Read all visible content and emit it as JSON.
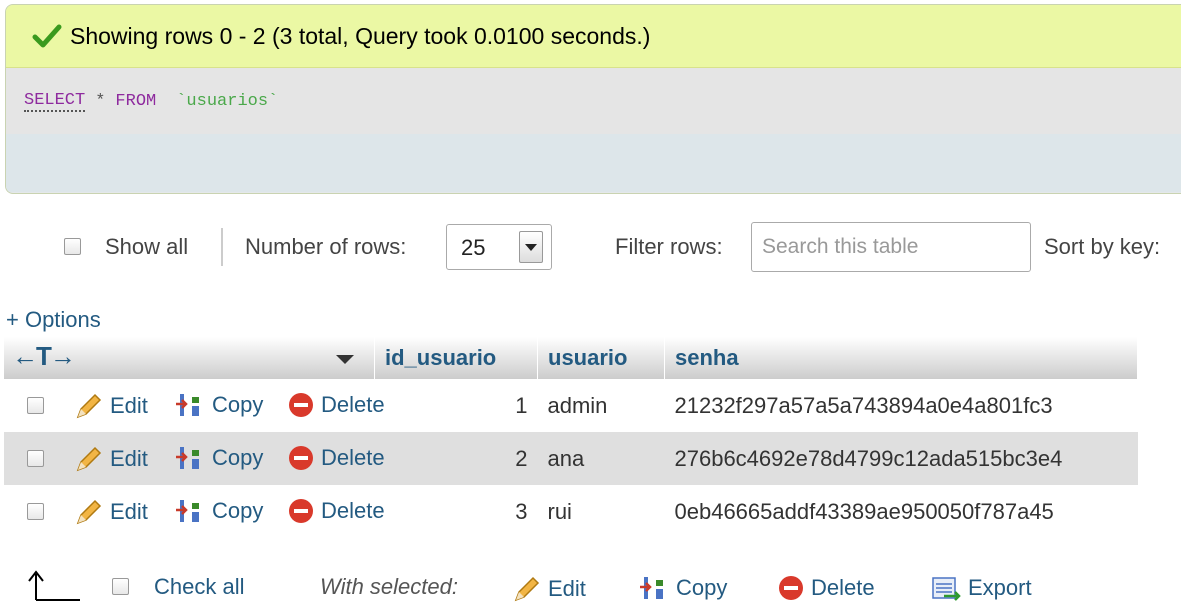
{
  "result": {
    "message": "Showing rows 0 - 2 (3 total, Query took 0.0100 seconds.)",
    "sql": {
      "select": "SELECT",
      "star": "*",
      "from": "FROM",
      "table": "`usuarios`"
    }
  },
  "nav": {
    "show_all": "Show all",
    "number_of_rows_label": "Number of rows:",
    "rows_value": "25",
    "filter_label": "Filter rows:",
    "search_placeholder": "Search this table",
    "sort_by": "Sort by key:"
  },
  "options_link": "+ Options",
  "table": {
    "arrows": "←T→",
    "columns": [
      "id_usuario",
      "usuario",
      "senha"
    ],
    "action_labels": {
      "edit": "Edit",
      "copy": "Copy",
      "delete": "Delete"
    },
    "rows": [
      {
        "id": "1",
        "usuario": "admin",
        "senha": "21232f297a57a5a743894a0e4a801fc3"
      },
      {
        "id": "2",
        "usuario": "ana",
        "senha": "276b6c4692e78d4799c12ada515bc3e4"
      },
      {
        "id": "3",
        "usuario": "rui",
        "senha": "0eb46665addf43389ae950050f787a45"
      }
    ]
  },
  "bottom": {
    "check_all": "Check all",
    "with_selected": "With selected:",
    "edit": "Edit",
    "copy": "Copy",
    "delete": "Delete",
    "export": "Export"
  },
  "colors": {
    "success_bg": "#ebf8a4",
    "link": "#235a81",
    "row_even": "#dfdfdf"
  }
}
